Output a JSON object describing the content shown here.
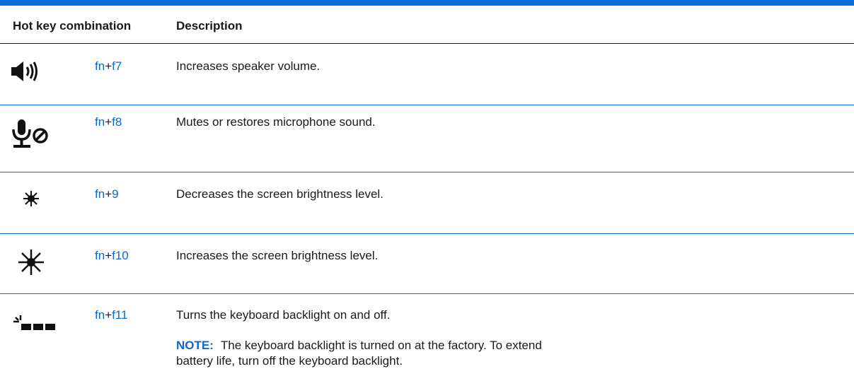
{
  "table": {
    "header": {
      "combination": "Hot key combination",
      "description": "Description"
    },
    "rows": [
      {
        "icon": "speaker-volume-up-icon",
        "key1": "fn",
        "plus": "+",
        "key2": "f7",
        "description": "Increases speaker volume."
      },
      {
        "icon": "microphone-mute-icon",
        "key1": "fn",
        "plus": "+",
        "key2": "f8",
        "description": "Mutes or restores microphone sound."
      },
      {
        "icon": "brightness-down-icon",
        "key1": "fn",
        "plus": "+",
        "key2": "9",
        "description": "Decreases the screen brightness level."
      },
      {
        "icon": "brightness-up-icon",
        "key1": "fn",
        "plus": "+",
        "key2": "f10",
        "description": "Increases the screen brightness level."
      },
      {
        "icon": "keyboard-backlight-icon",
        "key1": "fn",
        "plus": "+",
        "key2": "f11",
        "description": "Turns the keyboard backlight on and off.",
        "note_label": "NOTE:",
        "note_text": "The keyboard backlight is turned on at the factory. To extend battery life, turn off the keyboard backlight."
      }
    ]
  },
  "colors": {
    "accent_blue": "#0d6ed8",
    "link_blue": "#1266c7",
    "text": "#1a1a1a"
  }
}
